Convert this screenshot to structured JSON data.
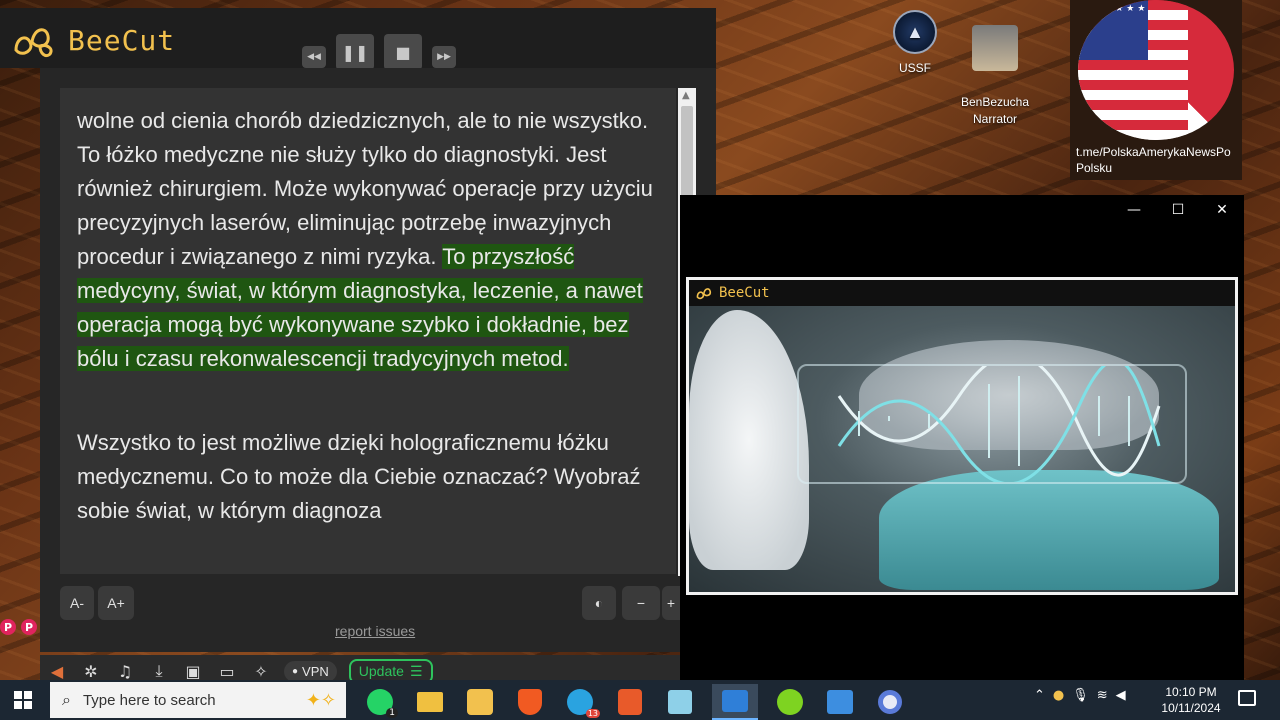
{
  "reader": {
    "brand": "BeeCut",
    "paragraph1_plain": "wolne od cienia chorób dziedzicznych, ale to nie wszystko. To łóżko medyczne nie służy tylko do diagnostyki. Jest również chirurgiem. Może wykonywać operacje przy użyciu precyzyjnych laserów, eliminując potrzebę inwazyjnych procedur i związanego z nimi ryzyka.",
    "paragraph1_highlight": "To przyszłość medycyny, świat, w którym diagnostyka, leczenie, a nawet operacja mogą być wykonywane szybko i dokładnie, bez bólu i czasu rekonwalescencji tradycyjnych metod.",
    "paragraph2": "Wszystko to jest możliwe dzięki holograficznemu łóżku medycznemu. Co to może dla Ciebie oznaczać? Wyobraź sobie świat, w którym diagnoza",
    "font_decrease": "A-",
    "font_increase": "A+",
    "zoom_minus": "−",
    "zoom_plus": "+",
    "report_link": "report issues",
    "highlight_color": "#1f5611"
  },
  "browser_toolbar": {
    "vpn_label": "VPN",
    "update_label": "Update"
  },
  "desktop_icons": [
    {
      "label": "USSF"
    },
    {
      "label": "BenBezucha\nNarrator"
    }
  ],
  "flag_tile": {
    "caption": "t.me/PolskaAmerykaNewsPo Polsku"
  },
  "video_window": {
    "brand": "BeeCut"
  },
  "taskbar": {
    "search_placeholder": "Type here to search",
    "telegram_badge": "13",
    "whatsapp_badge": "1",
    "time": "10:10 PM",
    "date": "10/11/2024"
  }
}
